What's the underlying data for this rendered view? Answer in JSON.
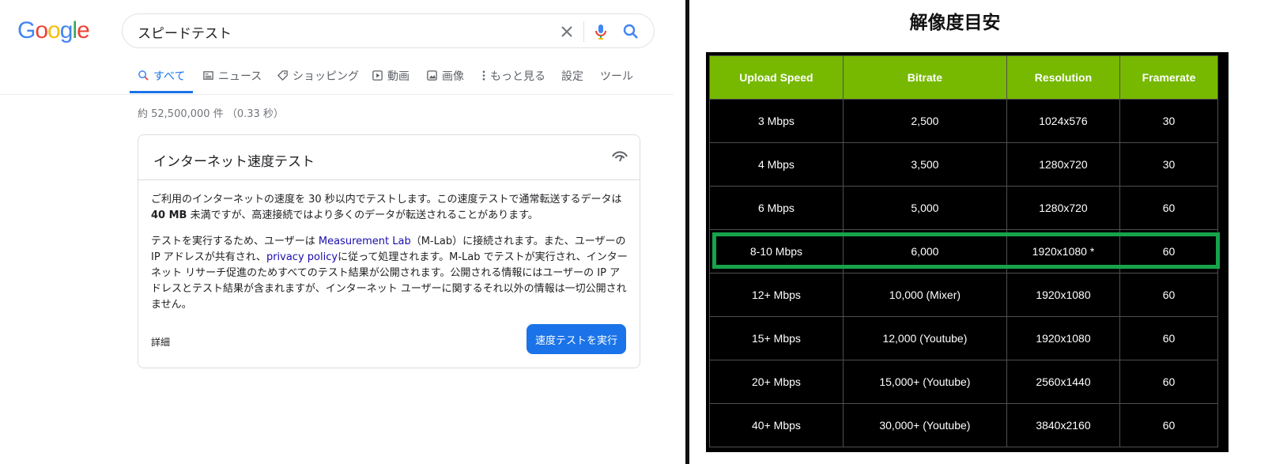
{
  "google": {
    "logo_text": "Google",
    "search": {
      "query": "スピードテスト"
    },
    "tabs": [
      {
        "label": "すべて",
        "icon": "search-icon",
        "active": true
      },
      {
        "label": "ニュース",
        "icon": "news-icon",
        "active": false
      },
      {
        "label": "ショッピング",
        "icon": "tag-icon",
        "active": false
      },
      {
        "label": "動画",
        "icon": "video-icon",
        "active": false
      },
      {
        "label": "画像",
        "icon": "image-icon",
        "active": false
      },
      {
        "label": "もっと見る",
        "icon": "more-vert-icon",
        "active": false
      },
      {
        "label": "設定",
        "icon": "",
        "active": false
      },
      {
        "label": "ツール",
        "icon": "",
        "active": false
      }
    ],
    "result_stats": "約 52,500,000 件 （0.33 秒）",
    "card": {
      "title": "インターネット速度テスト",
      "p1_a": "ご利用のインターネットの速度を 30 秒以内でテストします。この速度テストで通常転送するデータは ",
      "p1_bold": "40 MB",
      "p1_b": " 未満ですが、高速接続ではより多くのデータが転送されることがあります。",
      "p2_a": "テストを実行するため、ユーザーは ",
      "p2_link1": "Measurement Lab",
      "p2_b": "（M-Lab）に接続されます。また、ユーザーの IP アドレスが共有され、",
      "p2_link2": "privacy policy",
      "p2_c": "に従って処理されます。M-Lab でテストが実行され、インターネット リサーチ促進のためすべてのテスト結果が公開されます。公開される情報にはユーザーの IP アドレスとテスト結果が含まれますが、インターネット ユーザーに関するそれ以外の情報は一切公開されません。",
      "details_label": "詳細",
      "run_button_label": "速度テストを実行"
    },
    "colors": {
      "accent": "#1a73e8",
      "link": "#1a0dab"
    }
  },
  "resolution_table": {
    "title": "解像度目安",
    "header_color": "#76b900",
    "highlight_color": "#16a34a",
    "columns": [
      "Upload Speed",
      "Bitrate",
      "Resolution",
      "Framerate"
    ],
    "rows": [
      [
        "3 Mbps",
        "2,500",
        "1024x576",
        "30"
      ],
      [
        "4 Mbps",
        "3,500",
        "1280x720",
        "30"
      ],
      [
        "6 Mbps",
        "5,000",
        "1280x720",
        "60"
      ],
      [
        "8-10 Mbps",
        "6,000",
        "1920x1080 *",
        "60"
      ],
      [
        "12+ Mbps",
        "10,000 (Mixer)",
        "1920x1080",
        "60"
      ],
      [
        "15+ Mbps",
        "12,000 (Youtube)",
        "1920x1080",
        "60"
      ],
      [
        "20+ Mbps",
        "15,000+ (Youtube)",
        "2560x1440",
        "60"
      ],
      [
        "40+ Mbps",
        "30,000+ (Youtube)",
        "3840x2160",
        "60"
      ]
    ],
    "highlighted_row": 3
  }
}
